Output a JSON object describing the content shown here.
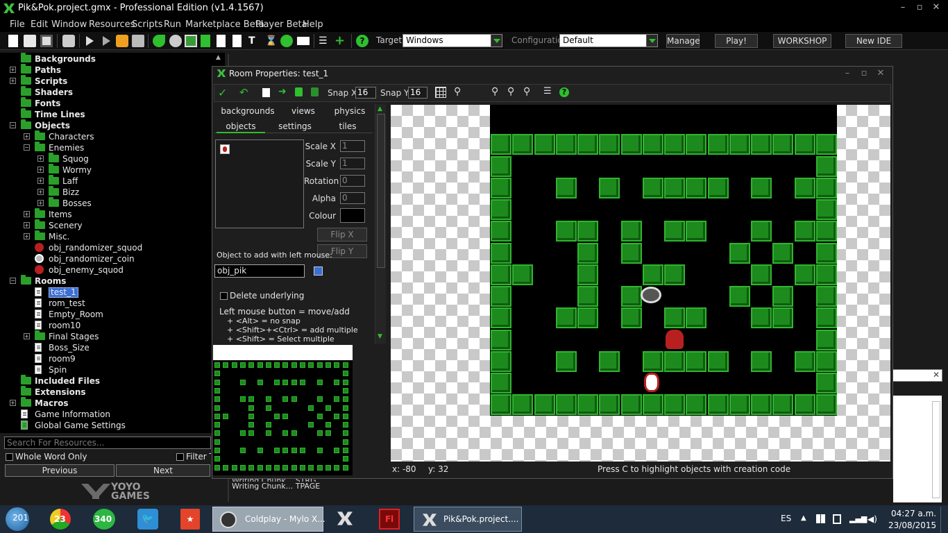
{
  "window": {
    "title": "Pik&Pok.project.gmx  -  Professional Edition (v1.4.1567)",
    "controls": [
      "–",
      "▫",
      "✕"
    ]
  },
  "menu": [
    {
      "label": "File"
    },
    {
      "label": "Edit"
    },
    {
      "label": "Window"
    },
    {
      "label": "Resources"
    },
    {
      "label": "Scripts"
    },
    {
      "label": "Run"
    },
    {
      "label": "Marketplace Beta"
    },
    {
      "label": "Player Beta"
    },
    {
      "label": "Help"
    }
  ],
  "toolbar": {
    "target_label": "Target:",
    "target_value": "Windows",
    "config_label": "Configuration:",
    "config_value": "Default",
    "manage": "Manage",
    "play": "Play!",
    "workshop": "WORKSHOP",
    "new_ide": "New IDE"
  },
  "tree": [
    {
      "label": "Backgrounds",
      "bold": true,
      "level": 0,
      "expander": "",
      "icon": "folder"
    },
    {
      "label": "Paths",
      "bold": true,
      "level": 0,
      "expander": "+",
      "icon": "folder"
    },
    {
      "label": "Scripts",
      "bold": true,
      "level": 0,
      "expander": "+",
      "icon": "folder"
    },
    {
      "label": "Shaders",
      "bold": true,
      "level": 0,
      "expander": "",
      "icon": "folder"
    },
    {
      "label": "Fonts",
      "bold": true,
      "level": 0,
      "expander": "",
      "icon": "folder"
    },
    {
      "label": "Time Lines",
      "bold": true,
      "level": 0,
      "expander": "",
      "icon": "folder"
    },
    {
      "label": "Objects",
      "bold": true,
      "level": 0,
      "expander": "−",
      "icon": "folder"
    },
    {
      "label": "Characters",
      "bold": false,
      "level": 1,
      "expander": "+",
      "icon": "folder"
    },
    {
      "label": "Enemies",
      "bold": false,
      "level": 1,
      "expander": "−",
      "icon": "folder"
    },
    {
      "label": "Squog",
      "bold": false,
      "level": 2,
      "expander": "+",
      "icon": "folder"
    },
    {
      "label": "Wormy",
      "bold": false,
      "level": 2,
      "expander": "+",
      "icon": "folder"
    },
    {
      "label": "Laff",
      "bold": false,
      "level": 2,
      "expander": "+",
      "icon": "folder"
    },
    {
      "label": "Bizz",
      "bold": false,
      "level": 2,
      "expander": "+",
      "icon": "folder"
    },
    {
      "label": "Bosses",
      "bold": false,
      "level": 2,
      "expander": "+",
      "icon": "folder"
    },
    {
      "label": "Items",
      "bold": false,
      "level": 1,
      "expander": "+",
      "icon": "folder"
    },
    {
      "label": "Scenery",
      "bold": false,
      "level": 1,
      "expander": "+",
      "icon": "folder"
    },
    {
      "label": "Misc.",
      "bold": false,
      "level": 1,
      "expander": "+",
      "icon": "folder"
    },
    {
      "label": "obj_randomizer_squod",
      "bold": false,
      "level": 1,
      "expander": "",
      "icon": "object"
    },
    {
      "label": "obj_randomizer_coin",
      "bold": false,
      "level": 1,
      "expander": "",
      "icon": "coin"
    },
    {
      "label": "obj_enemy_squod",
      "bold": false,
      "level": 1,
      "expander": "",
      "icon": "object"
    },
    {
      "label": "Rooms",
      "bold": true,
      "level": 0,
      "expander": "−",
      "icon": "folder"
    },
    {
      "label": "test_1",
      "bold": false,
      "level": 1,
      "expander": "",
      "icon": "room",
      "selected": true
    },
    {
      "label": "rom_test",
      "bold": false,
      "level": 1,
      "expander": "",
      "icon": "room"
    },
    {
      "label": "Empty_Room",
      "bold": false,
      "level": 1,
      "expander": "",
      "icon": "room"
    },
    {
      "label": "room10",
      "bold": false,
      "level": 1,
      "expander": "",
      "icon": "room"
    },
    {
      "label": "Final Stages",
      "bold": false,
      "level": 1,
      "expander": "+",
      "icon": "folder"
    },
    {
      "label": "Boss_Size",
      "bold": false,
      "level": 1,
      "expander": "",
      "icon": "room"
    },
    {
      "label": "room9",
      "bold": false,
      "level": 1,
      "expander": "",
      "icon": "room"
    },
    {
      "label": "Spin",
      "bold": false,
      "level": 1,
      "expander": "",
      "icon": "room"
    },
    {
      "label": "Included Files",
      "bold": true,
      "level": 0,
      "expander": "",
      "icon": "folder"
    },
    {
      "label": "Extensions",
      "bold": true,
      "level": 0,
      "expander": "",
      "icon": "folder"
    },
    {
      "label": "Macros",
      "bold": true,
      "level": 0,
      "expander": "+",
      "icon": "folder"
    },
    {
      "label": "Game Information",
      "bold": false,
      "level": 0,
      "expander": "",
      "icon": "info"
    },
    {
      "label": "Global Game Settings",
      "bold": false,
      "level": 0,
      "expander": "",
      "icon": "check"
    }
  ],
  "search": {
    "placeholder": "Search For Resources...",
    "whole_word": "Whole Word Only",
    "filter": "Filter Tr",
    "previous": "Previous",
    "next": "Next"
  },
  "brand": {
    "line1": "YOYO",
    "line2": "GAMES"
  },
  "output": {
    "line1": "Writing Chunk... STRG",
    "line2": "Writing Chunk... TPAGE"
  },
  "room": {
    "title": "Room Properties: test_1",
    "snap_x_label": "Snap X:",
    "snap_x": "16",
    "snap_y_label": "Snap Y:",
    "snap_y": "16",
    "tabs_row1": [
      "backgrounds",
      "views",
      "physics"
    ],
    "tabs_row2": [
      "objects",
      "settings",
      "tiles"
    ],
    "active_tab": "objects",
    "scale_x_label": "Scale X",
    "scale_x": "1",
    "scale_y_label": "Scale Y",
    "scale_y": "1",
    "rotation_label": "Rotation",
    "rotation": "0",
    "alpha_label": "Alpha",
    "alpha": "0",
    "colour_label": "Colour",
    "colour": "#000000",
    "flip_x": "Flip X",
    "flip_y": "Flip Y",
    "add_label": "Object to add with left mouse:",
    "object": "obj_pik",
    "delete_underlying": "Delete underlying",
    "help": [
      "Left mouse button = move/add",
      "  + <Alt> = no snap",
      "  + <Shift>+<Ctrl> = add multiple",
      "  + <Shift> = Select multiple"
    ],
    "status_x": "x: -80",
    "status_y": "y: 32",
    "status_hint": "Press C to highlight objects with creation code"
  },
  "taskbar": {
    "items": [
      {
        "label": "201",
        "icon": "orb"
      },
      {
        "label": "23",
        "icon": "chrome"
      },
      {
        "label": "340",
        "icon": "whatsapp"
      },
      {
        "label": "",
        "icon": "twitter"
      },
      {
        "label": "",
        "icon": "bookmark"
      },
      {
        "label": "Coldplay - Mylo X...",
        "icon": "music"
      },
      {
        "label": "",
        "icon": "gamemaker"
      },
      {
        "label": "",
        "icon": "flash"
      },
      {
        "label": "Pik&Pok.project....",
        "icon": "gamemaker"
      }
    ],
    "lang": "ES",
    "time": "04:27 a.m.",
    "date": "23/08/2015"
  },
  "colors": {
    "accent": "#2fbf2f",
    "wall": "#1d8a1d",
    "title_bg": "#000000"
  }
}
